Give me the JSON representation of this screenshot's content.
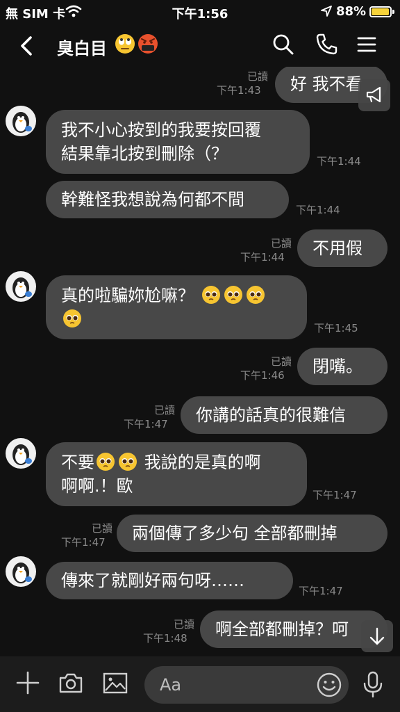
{
  "status_bar": {
    "carrier": "無 SIM 卡",
    "time": "下午1:56",
    "battery": "88%",
    "battery_level": 0.88,
    "battery_color": "#f7d33a"
  },
  "header": {
    "title": "臭白目",
    "title_emojis": [
      "eye-roll-emoji",
      "cursing-emoji"
    ],
    "icons": [
      "back-icon",
      "search-icon",
      "phone-icon",
      "menu-icon"
    ]
  },
  "messages": [
    {
      "id": "m1",
      "side": "right",
      "text": "好 我不看",
      "read": "已讀",
      "time": "下午1:43"
    },
    {
      "id": "m2",
      "side": "left",
      "lines": [
        "我不小心按到的我要按回覆",
        "結果靠北按到刪除（？"
      ],
      "time": "下午1:44"
    },
    {
      "id": "m3",
      "side": "left",
      "text": "幹難怪我想說為何都不間",
      "time": "下午1:44"
    },
    {
      "id": "m4",
      "side": "right",
      "text": "不用假",
      "read": "已讀",
      "time": "下午1:44"
    },
    {
      "id": "m5",
      "side": "left",
      "text": "真的啦騙妳尬嘛？",
      "time": "下午1:45"
    },
    {
      "id": "m6",
      "side": "right",
      "text": "閉嘴。",
      "read": "已讀",
      "time": "下午1:46"
    },
    {
      "id": "m7",
      "side": "right",
      "text": "你講的話真的很難信",
      "read": "已讀",
      "time": "下午1:47"
    },
    {
      "id": "m8",
      "side": "left",
      "text_a": "不要",
      "text_b": "我說的是真的啊",
      "line2": "啊啊.！歐",
      "time": "下午1:47"
    },
    {
      "id": "m9",
      "side": "right",
      "text": "兩個傳了多少句 全部都刪掉",
      "read": "已讀",
      "time": "下午1:47"
    },
    {
      "id": "m10",
      "side": "left",
      "text": "傳來了就剛好兩句呀……",
      "time": "下午1:47"
    },
    {
      "id": "m11",
      "side": "right",
      "text": "啊全部都刪掉？呵",
      "read": "已讀",
      "time": "下午1:48"
    }
  ],
  "input": {
    "placeholder": "Aa"
  },
  "colors": {
    "background": "#111111",
    "bubble": "#484848",
    "meta_text": "#8a8a8a"
  }
}
